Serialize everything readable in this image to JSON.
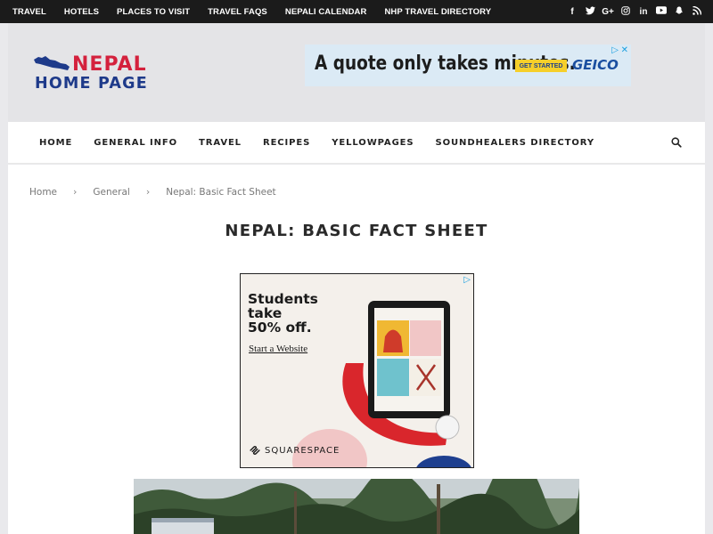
{
  "topbar": {
    "links": [
      "TRAVEL",
      "HOTELS",
      "PLACES TO VISIT",
      "TRAVEL FAQS",
      "NEPALI CALENDAR",
      "NHP TRAVEL DIRECTORY"
    ],
    "social": [
      {
        "icon": "facebook-icon",
        "glyph": "f"
      },
      {
        "icon": "twitter-icon",
        "glyph": "t"
      },
      {
        "icon": "google-plus-icon",
        "glyph": "G+"
      },
      {
        "icon": "instagram-icon",
        "glyph": "◎"
      },
      {
        "icon": "linkedin-icon",
        "glyph": "in"
      },
      {
        "icon": "youtube-icon",
        "glyph": "▶"
      },
      {
        "icon": "snapchat-icon",
        "glyph": "☃"
      },
      {
        "icon": "rss-icon",
        "glyph": "≋"
      }
    ]
  },
  "logo": {
    "line1": "NEPAL",
    "line2": "HOME PAGE"
  },
  "header_ad": {
    "headline": "A quote only takes minutes.",
    "button": "GET STARTED",
    "brand": "GEICO"
  },
  "nav": {
    "items": [
      "HOME",
      "GENERAL INFO",
      "TRAVEL",
      "RECIPES",
      "YELLOWPAGES",
      "SOUNDHEALERS DIRECTORY"
    ]
  },
  "breadcrumb": {
    "home": "Home",
    "category": "General",
    "current": "Nepal: Basic Fact Sheet"
  },
  "page_title": "NEPAL: BASIC FACT SHEET",
  "square_ad": {
    "line1": "Students",
    "line2": "take",
    "line3": "50% off.",
    "cta": "Start a Website",
    "brand": "SQUARESPACE"
  },
  "colors": {
    "topbar": "#1b1b1b",
    "logo_red": "#d4213d",
    "logo_blue": "#1e3a8a",
    "geico_blue": "#1b4fa0",
    "geico_yellow": "#f6cf2a"
  }
}
